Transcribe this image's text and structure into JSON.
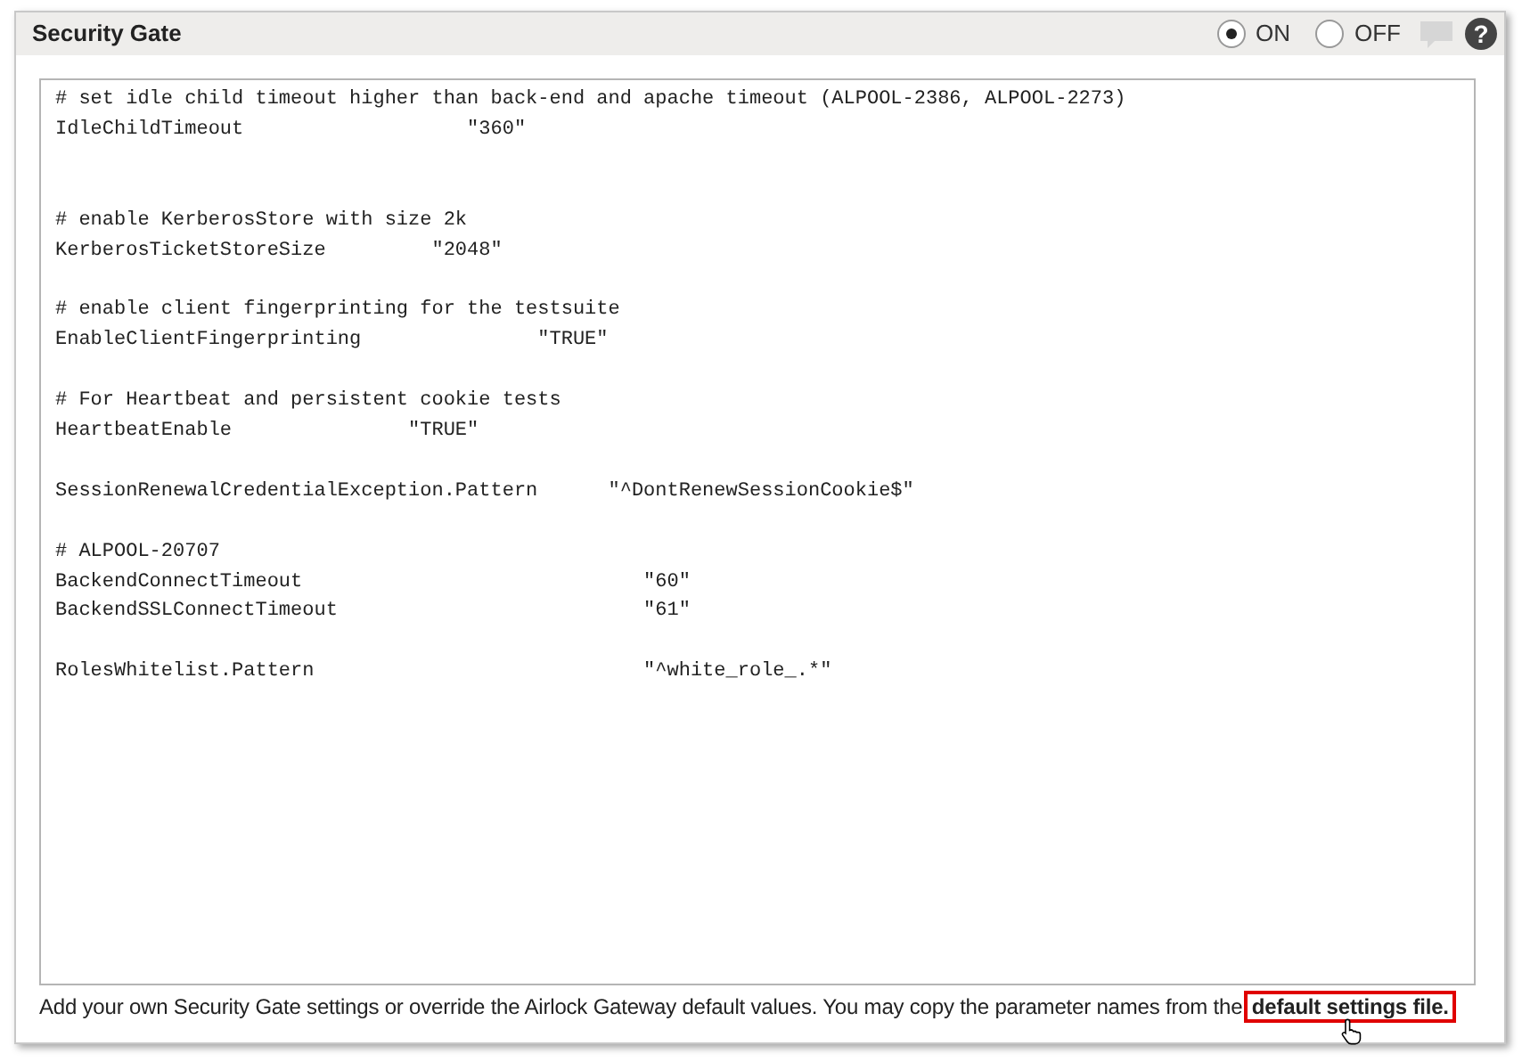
{
  "panel": {
    "title": "Security Gate",
    "mode": [
      {
        "label": "ON",
        "selected": true
      },
      {
        "label": "OFF",
        "selected": false
      }
    ],
    "help": "?",
    "editor": {
      "value": "# set idle child timeout higher than back-end and apache timeout (ALPOOL-2386, ALPOOL-2273)\nIdleChildTimeout                   \"360\"\n\n\n# enable KerberosStore with size 2k\nKerberosTicketStoreSize         \"2048\"\n\n# enable client fingerprinting for the testsuite\nEnableClientFingerprinting               \"TRUE\"\n\n# For Heartbeat and persistent cookie tests\nHeartbeatEnable               \"TRUE\"\n\nSessionRenewalCredentialException.Pattern      \"^DontRenewSessionCookie$\"\n\n# ALPOOL-20707\nBackendConnectTimeout                             \"60\"\nBackendSSLConnectTimeout                          \"61\"\n\nRolesWhitelist.Pattern                            \"^white_role_.*\""
    },
    "footer": {
      "text": "Add your own Security Gate settings or override the Airlock Gateway default values. You may copy the parameter names from the",
      "link": "default settings file."
    }
  }
}
